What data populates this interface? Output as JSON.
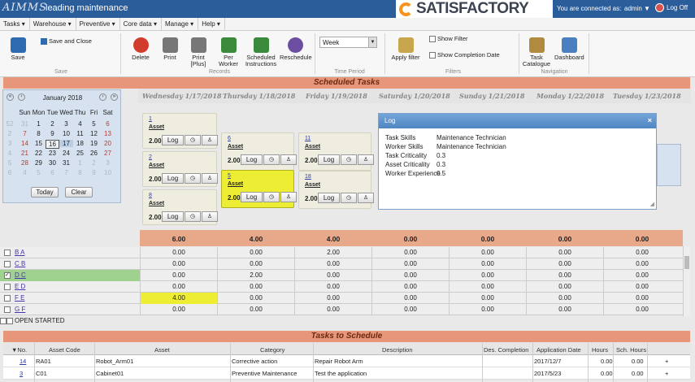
{
  "app": {
    "logo": "AIMMS",
    "tagline": "leading maintenance",
    "brand": "SATISFACTORY",
    "connected_label": "You are connected as:",
    "user": "admin",
    "logoff": "Log Off"
  },
  "menu": [
    "Tasks",
    "Warehouse",
    "Preventive",
    "Core data",
    "Manage",
    "Help"
  ],
  "ribbon": {
    "save": "Save",
    "save_close": "Save and Close",
    "group_save": "Save",
    "delete": "Delete",
    "print": "Print",
    "print_plus": "Print [Plus]",
    "per_worker": "Per Worker",
    "sched_instr": "Scheduled Instructions",
    "reschedule": "Reschedule",
    "group_records": "Records",
    "period_value": "Week",
    "group_period": "Time Period",
    "apply_filter": "Apply filter",
    "show_filter": "Show Filter",
    "show_completion": "Show Completion Date",
    "group_filters": "Filters",
    "task_catalogue": "Task Catalogue",
    "dashboard": "Dashboard",
    "group_navigation": "Navigation"
  },
  "scheduled_title": "Scheduled Tasks",
  "days": [
    "Wednesday 1/17/2018",
    "Thursday 1/18/2018",
    "Friday 1/19/2018",
    "Saturday 1/20/2018",
    "Sunday 1/21/2018",
    "Monday 1/22/2018",
    "Tuesday 1/23/2018"
  ],
  "calendar": {
    "month": "January 2018",
    "weekdays": [
      "Sun",
      "Mon",
      "Tue",
      "Wed",
      "Thu",
      "Fri",
      "Sat"
    ],
    "weeks": [
      [
        "31",
        "1",
        "2",
        "3",
        "4",
        "5",
        "6"
      ],
      [
        "7",
        "8",
        "9",
        "10",
        "11",
        "12",
        "13"
      ],
      [
        "14",
        "15",
        "16",
        "17",
        "18",
        "19",
        "20"
      ],
      [
        "21",
        "22",
        "23",
        "24",
        "25",
        "26",
        "27"
      ],
      [
        "28",
        "29",
        "30",
        "31",
        "1",
        "2",
        "3"
      ],
      [
        "4",
        "5",
        "6",
        "7",
        "8",
        "9",
        "10"
      ]
    ],
    "today_btn": "Today",
    "clear_btn": "Clear"
  },
  "tasks": [
    {
      "id": "1",
      "asset": "Asset",
      "hours": "2.00",
      "log": "Log"
    },
    {
      "id": "2",
      "asset": "Asset",
      "hours": "2.00",
      "log": "Log"
    },
    {
      "id": "8",
      "asset": "Asset",
      "hours": "2.00",
      "log": "Log"
    },
    {
      "id": "6",
      "asset": "Asset",
      "hours": "2.00",
      "log": "Log"
    },
    {
      "id": "5",
      "asset": "Asset",
      "hours": "2.00",
      "log": "Log"
    },
    {
      "id": "11",
      "asset": "Asset",
      "hours": "2.00",
      "log": "Log"
    },
    {
      "id": "18",
      "asset": "Asset",
      "hours": "2.00",
      "log": "Log"
    }
  ],
  "log_popup": {
    "title": "Log",
    "rows": [
      {
        "k": "Task Skills",
        "v": "Maintenance Technician"
      },
      {
        "k": "Worker Skills",
        "v": "Maintenance Technician"
      },
      {
        "k": "Task Criticality",
        "v": "0.3"
      },
      {
        "k": "Asset Criticality",
        "v": "0.3"
      },
      {
        "k": "Worker Experience",
        "v": "0.5"
      }
    ]
  },
  "totals": [
    "6.00",
    "4.00",
    "4.00",
    "0.00",
    "0.00",
    "0.00",
    "0.00"
  ],
  "workers": [
    {
      "name": "B A",
      "values": [
        "0.00",
        "0.00",
        "2.00",
        "0.00",
        "0.00",
        "0.00",
        "0.00"
      ]
    },
    {
      "name": "C B",
      "values": [
        "0.00",
        "0.00",
        "0.00",
        "0.00",
        "0.00",
        "0.00",
        "0.00"
      ]
    },
    {
      "name": "D C",
      "values": [
        "0.00",
        "2.00",
        "0.00",
        "0.00",
        "0.00",
        "0.00",
        "0.00"
      ]
    },
    {
      "name": "E D",
      "values": [
        "0.00",
        "0.00",
        "0.00",
        "0.00",
        "0.00",
        "0.00",
        "0.00"
      ]
    },
    {
      "name": "F E",
      "values": [
        "4.00",
        "0.00",
        "0.00",
        "0.00",
        "0.00",
        "0.00",
        "0.00"
      ]
    },
    {
      "name": "G F",
      "values": [
        "0.00",
        "0.00",
        "0.00",
        "0.00",
        "0.00",
        "0.00",
        "0.00"
      ]
    }
  ],
  "open_started": "OPEN STARTED",
  "tts_title": "Tasks to Schedule",
  "tts_headers": [
    "▼No.",
    "Asset Code",
    "Asset",
    "Category",
    "Description",
    "Des. Completion",
    "Application Date",
    "Hours",
    "Sch. Hours"
  ],
  "tts_rows": [
    {
      "no": "14",
      "code": "RA01",
      "asset": "Robot_Arm01",
      "category": "Corrective action",
      "desc": "Repair Robot Arm",
      "comp": "",
      "date": "2017/12/7",
      "hours": "0.00",
      "sch": "0.00",
      "add": "+"
    },
    {
      "no": "3",
      "code": "C01",
      "asset": "Cabinet01",
      "category": "Preventive Maintenance",
      "desc": "Test the application",
      "comp": "",
      "date": "2017/5/23",
      "hours": "0.00",
      "sch": "0.00",
      "add": "+"
    }
  ],
  "colors": {
    "header": "#2c5d9b",
    "section": "#e7967a",
    "totals": "#e8a88a",
    "selected": "#eded33"
  }
}
